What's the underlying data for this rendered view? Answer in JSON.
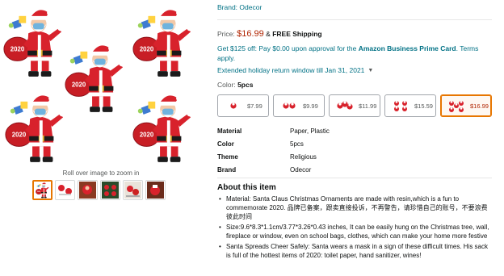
{
  "hero": {
    "figure_text": "2020",
    "zoom_hint": "Roll over image to zoom in"
  },
  "thumbnails": [
    {
      "name": "thumb-1",
      "active": true
    },
    {
      "name": "thumb-2",
      "active": false
    },
    {
      "name": "thumb-3",
      "active": false
    },
    {
      "name": "thumb-4",
      "active": false
    },
    {
      "name": "thumb-5",
      "active": false
    },
    {
      "name": "thumb-6",
      "active": false
    }
  ],
  "product": {
    "brand_link": "Brand: Odecor",
    "price_label": "Price:",
    "price": "$16.99",
    "amp": "&",
    "shipping": "FREE Shipping",
    "promo_prefix": "Get $125 off: Pay $0.00 upon approval for the ",
    "promo_bold": "Amazon Business Prime Card",
    "promo_suffix": ". Terms apply.",
    "holiday": "Extended holiday return window till Jan 31, 2021",
    "color_label": "Color:",
    "color_value": "5pcs"
  },
  "swatches": [
    {
      "price": "$7.99",
      "count": 1,
      "selected": false
    },
    {
      "price": "$9.99",
      "count": 2,
      "selected": false
    },
    {
      "price": "$11.99",
      "count": 3,
      "selected": false
    },
    {
      "price": "$15.59",
      "count": 4,
      "selected": false
    },
    {
      "price": "$16.99",
      "count": 5,
      "selected": true
    }
  ],
  "specs": [
    {
      "key": "Material",
      "value": "Paper, Plastic"
    },
    {
      "key": "Color",
      "value": "5pcs"
    },
    {
      "key": "Theme",
      "value": "Religious"
    },
    {
      "key": "Brand",
      "value": "Odecor"
    }
  ],
  "about": {
    "title": "About this item",
    "bullets": [
      "Material: Santa Claus Christmas Ornaments are made with resin,which is a fun to commemorate 2020. 品牌已备案，跟卖直接投诉，不再警告，请珍惜自己的账号，不要浪费彼此时间",
      "Size:9.6*8.3*1.1cm/3.77*3.26*0.43 inches, It can be easily hung on the Christmas tree, wall, fireplace or window, even on school bags, clothes, which can make your home more festive",
      "Santa Spreads Cheer Safely: Santa wears a mask in a sign of these difficult times. His sack is full of the hottest items of 2020: toilet paper, hand sanitizer, wines!"
    ]
  },
  "colors": {
    "link": "#007185",
    "price": "#b12704",
    "selected_border": "#e77600",
    "santa_red": "#d8222c",
    "mask_blue": "#6fb3dd"
  }
}
